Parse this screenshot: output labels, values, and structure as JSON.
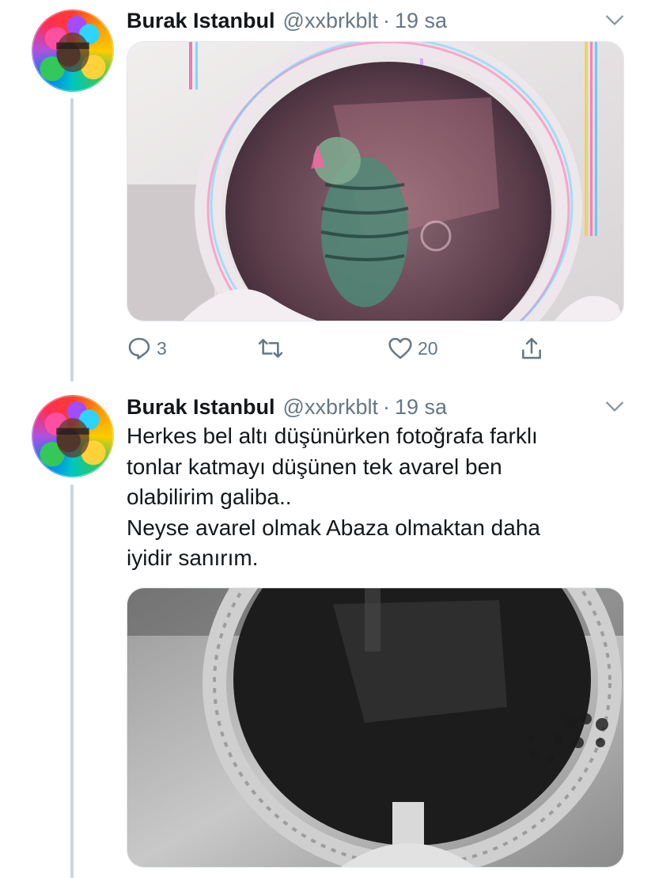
{
  "tweets": [
    {
      "author_name": "Burak Istanbul",
      "handle": "@xxbrkblt",
      "separator": "·",
      "time": "19 sa",
      "text_lines": [],
      "actions": {
        "replies": "3",
        "retweets": "",
        "likes": "20"
      }
    },
    {
      "author_name": "Burak Istanbul",
      "handle": "@xxbrkblt",
      "separator": "·",
      "time": "19 sa",
      "text_lines": [
        "Herkes bel altı düşünürken fotoğrafa farklı",
        "tonlar katmayı düşünen tek avarel ben",
        "olabilirim galiba..",
        "Neyse avarel olmak Abaza olmaktan daha",
        "iyidir sanırım."
      ]
    }
  ],
  "icons": {
    "reply": "reply-icon",
    "retweet": "retweet-icon",
    "like": "heart-icon",
    "share": "share-icon",
    "menu": "chevron-down-icon"
  },
  "colors": {
    "text_primary": "#14171a",
    "text_secondary": "#657786",
    "thread_line": "#ccd6dd"
  }
}
